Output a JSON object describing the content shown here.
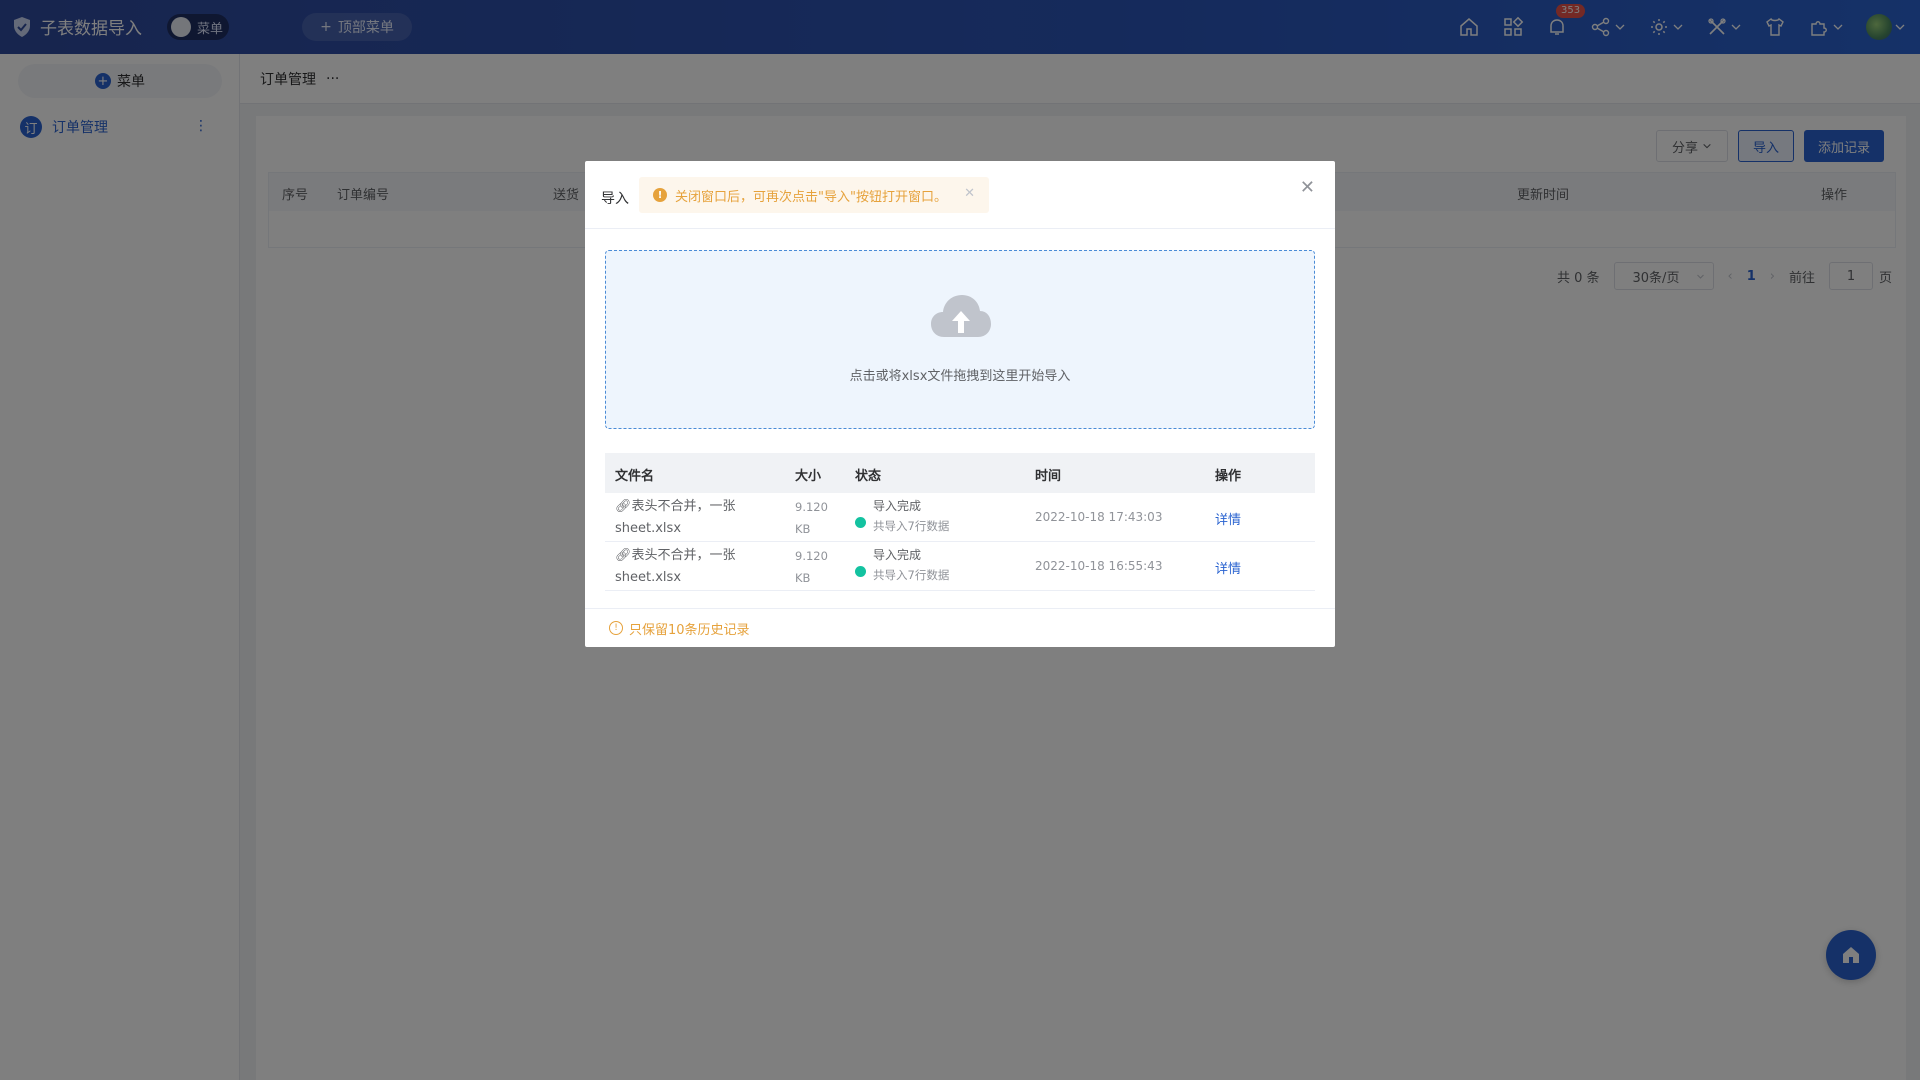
{
  "app": {
    "title": "子表数据导入",
    "menu_toggle_label": "菜单",
    "top_menu_label": "顶部菜单"
  },
  "topbar": {
    "notification_count": "353"
  },
  "sidebar": {
    "menu_button_label": "菜单",
    "items": [
      {
        "label": "订单管理",
        "icon_text": "订"
      }
    ]
  },
  "page": {
    "breadcrumb": "订单管理",
    "more": "···"
  },
  "toolbar": {
    "share_label": "分享",
    "import_label": "导入",
    "add_label": "添加记录"
  },
  "grid": {
    "columns": [
      "序号",
      "订单编号",
      "送货",
      "更新时间",
      "操作"
    ]
  },
  "pager": {
    "total": "共 0 条",
    "page_size": "30条/页",
    "current_page": "1",
    "goto_prefix": "前往",
    "goto_value": "1",
    "goto_suffix": "页"
  },
  "modal": {
    "title": "导入",
    "alert_text": "关闭窗口后，可再次点击\"导入\"按钮打开窗口。",
    "dropzone_text": "点击或将xlsx文件拖拽到这里开始导入",
    "table_headers": {
      "name": "文件名",
      "size": "大小",
      "status": "状态",
      "time": "时间",
      "action": "操作"
    },
    "rows": [
      {
        "name": "表头不合并，一张sheet.xlsx",
        "size": "9.120 KB",
        "status": "导入完成",
        "detail": "共导入7行数据",
        "time": "2022-10-18 17:43:03",
        "action": "详情"
      },
      {
        "name": "表头不合并，一张sheet.xlsx",
        "size": "9.120 KB",
        "status": "导入完成",
        "detail": "共导入7行数据",
        "time": "2022-10-18 16:55:43",
        "action": "详情"
      }
    ],
    "footer_text": "只保留10条历史记录"
  },
  "colors": {
    "primary": "#2a63d0",
    "warning": "#e6a23c",
    "success": "#13c2a0"
  }
}
